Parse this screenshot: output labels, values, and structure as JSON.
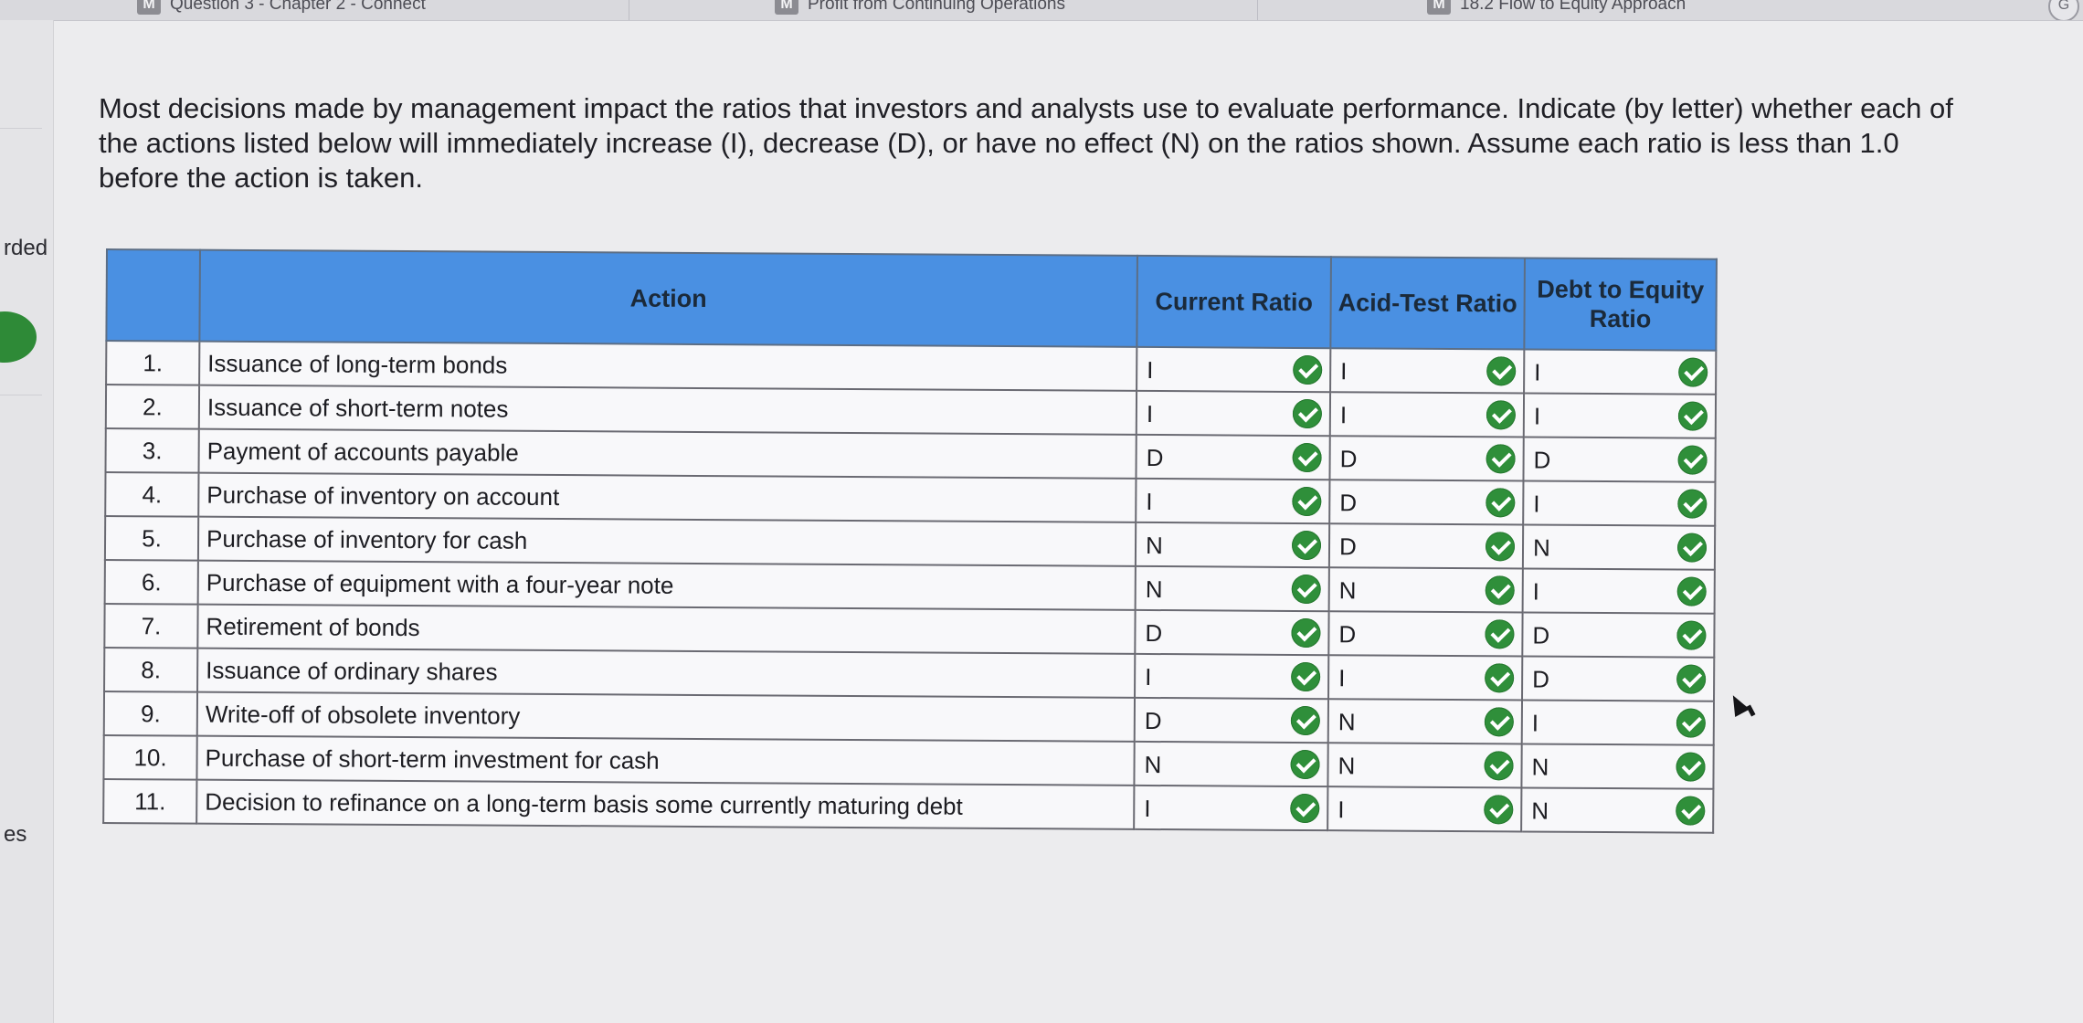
{
  "browser": {
    "tabs": [
      {
        "badge": "M",
        "label": "Question 3 - Chapter 2 - Connect"
      },
      {
        "badge": "M",
        "label": "Profit from Continuing Operations"
      },
      {
        "badge": "M",
        "label": "18.2 Flow to Equity Approach"
      }
    ],
    "corner_icon": "G"
  },
  "left_panel": {
    "fragment_top": "rded",
    "fragment_bottom": "es",
    "status_color": "#2e8a37"
  },
  "instructions": "Most decisions made by management impact the ratios that investors and analysts use to evaluate performance. Indicate (by letter) whether each of the actions listed below will immediately increase (I), decrease (D), or have no effect (N) on the ratios shown. Assume each ratio is less than 1.0 before the action is taken.",
  "table": {
    "headers": {
      "action": "Action",
      "current": "Current Ratio",
      "acid": "Acid-Test Ratio",
      "debt": "Debt to Equity Ratio"
    },
    "header_color": "#4a90e2",
    "check_color": "#2f8f3a",
    "check_icon": "check-circle-icon",
    "rows": [
      {
        "num": "1.",
        "action": "Issuance of long-term bonds",
        "current": "I",
        "acid": "I",
        "debt": "I"
      },
      {
        "num": "2.",
        "action": "Issuance of short-term notes",
        "current": "I",
        "acid": "I",
        "debt": "I"
      },
      {
        "num": "3.",
        "action": "Payment of accounts payable",
        "current": "D",
        "acid": "D",
        "debt": "D"
      },
      {
        "num": "4.",
        "action": "Purchase of inventory on account",
        "current": "I",
        "acid": "D",
        "debt": "I"
      },
      {
        "num": "5.",
        "action": "Purchase of inventory for cash",
        "current": "N",
        "acid": "D",
        "debt": "N"
      },
      {
        "num": "6.",
        "action": "Purchase of equipment with a four-year note",
        "current": "N",
        "acid": "N",
        "debt": "I"
      },
      {
        "num": "7.",
        "action": "Retirement of bonds",
        "current": "D",
        "acid": "D",
        "debt": "D"
      },
      {
        "num": "8.",
        "action": "Issuance of ordinary shares",
        "current": "I",
        "acid": "I",
        "debt": "D"
      },
      {
        "num": "9.",
        "action": "Write-off of obsolete inventory",
        "current": "D",
        "acid": "N",
        "debt": "I"
      },
      {
        "num": "10.",
        "action": "Purchase of short-term investment for cash",
        "current": "N",
        "acid": "N",
        "debt": "N"
      },
      {
        "num": "11.",
        "action": "Decision to refinance on a long-term basis some currently maturing debt",
        "current": "I",
        "acid": "I",
        "debt": "N"
      }
    ]
  }
}
